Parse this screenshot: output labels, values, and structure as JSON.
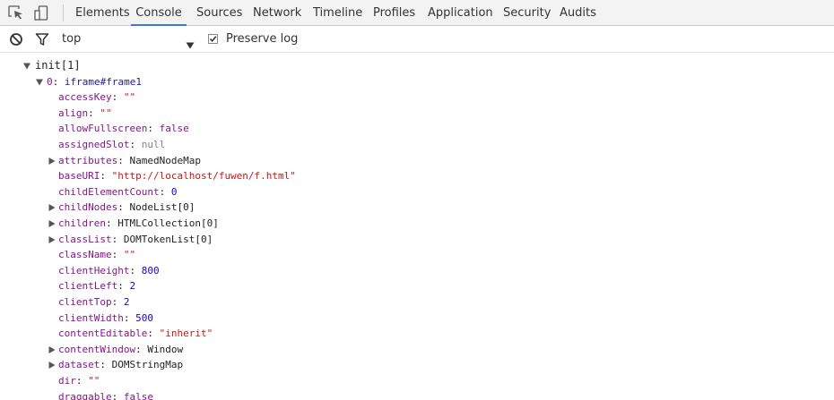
{
  "tabs": [
    {
      "label": "Elements",
      "active": false
    },
    {
      "label": "Console",
      "active": true
    },
    {
      "label": "Sources",
      "active": false
    },
    {
      "label": "Network",
      "active": false
    },
    {
      "label": "Timeline",
      "active": false
    },
    {
      "label": "Profiles",
      "active": false
    },
    {
      "label": "Application",
      "active": false
    },
    {
      "label": "Security",
      "active": false
    },
    {
      "label": "Audits",
      "active": false
    }
  ],
  "toolbar": {
    "context": "top",
    "preserve_log_label": "Preserve log",
    "preserve_log_checked": true
  },
  "colors": {
    "accent": "#3879d9",
    "property_name": "#881391",
    "string_value": "#c41a16",
    "number_value": "#1c00cf",
    "null_value": "#808080"
  },
  "icons": [
    "inspect-element-icon",
    "device-mode-icon",
    "clear-console-icon",
    "filter-icon",
    "dropdown-arrow-icon",
    "checkbox-icon",
    "expand-triangle-icon",
    "collapse-triangle-icon"
  ],
  "console": {
    "root": {
      "label": "init[1]",
      "expanded": true
    },
    "item": {
      "index": "0",
      "sep": ": ",
      "tag": "iframe#frame1",
      "expanded": true
    },
    "properties": [
      {
        "name": "accessKey",
        "value": "\"\"",
        "type": "string",
        "expandable": false
      },
      {
        "name": "align",
        "value": "\"\"",
        "type": "string",
        "expandable": false
      },
      {
        "name": "allowFullscreen",
        "value": "false",
        "type": "bool",
        "expandable": false
      },
      {
        "name": "assignedSlot",
        "value": "null",
        "type": "null",
        "expandable": false
      },
      {
        "name": "attributes",
        "value": "NamedNodeMap",
        "type": "object",
        "expandable": true
      },
      {
        "name": "baseURI",
        "value": "\"http://localhost/fuwen/f.html\"",
        "type": "string",
        "expandable": false
      },
      {
        "name": "childElementCount",
        "value": "0",
        "type": "number",
        "expandable": false
      },
      {
        "name": "childNodes",
        "value": "NodeList[0]",
        "type": "object",
        "expandable": true
      },
      {
        "name": "children",
        "value": "HTMLCollection[0]",
        "type": "object",
        "expandable": true
      },
      {
        "name": "classList",
        "value": "DOMTokenList[0]",
        "type": "object",
        "expandable": true
      },
      {
        "name": "className",
        "value": "\"\"",
        "type": "string",
        "expandable": false
      },
      {
        "name": "clientHeight",
        "value": "800",
        "type": "number",
        "expandable": false
      },
      {
        "name": "clientLeft",
        "value": "2",
        "type": "number",
        "expandable": false
      },
      {
        "name": "clientTop",
        "value": "2",
        "type": "number",
        "expandable": false
      },
      {
        "name": "clientWidth",
        "value": "500",
        "type": "number",
        "expandable": false
      },
      {
        "name": "contentEditable",
        "value": "\"inherit\"",
        "type": "string",
        "expandable": false
      },
      {
        "name": "contentWindow",
        "value": "Window",
        "type": "object",
        "expandable": true
      },
      {
        "name": "dataset",
        "value": "DOMStringMap",
        "type": "object",
        "expandable": true
      },
      {
        "name": "dir",
        "value": "\"\"",
        "type": "string",
        "expandable": false
      },
      {
        "name": "draggable",
        "value": "false",
        "type": "bool",
        "expandable": false
      }
    ]
  }
}
